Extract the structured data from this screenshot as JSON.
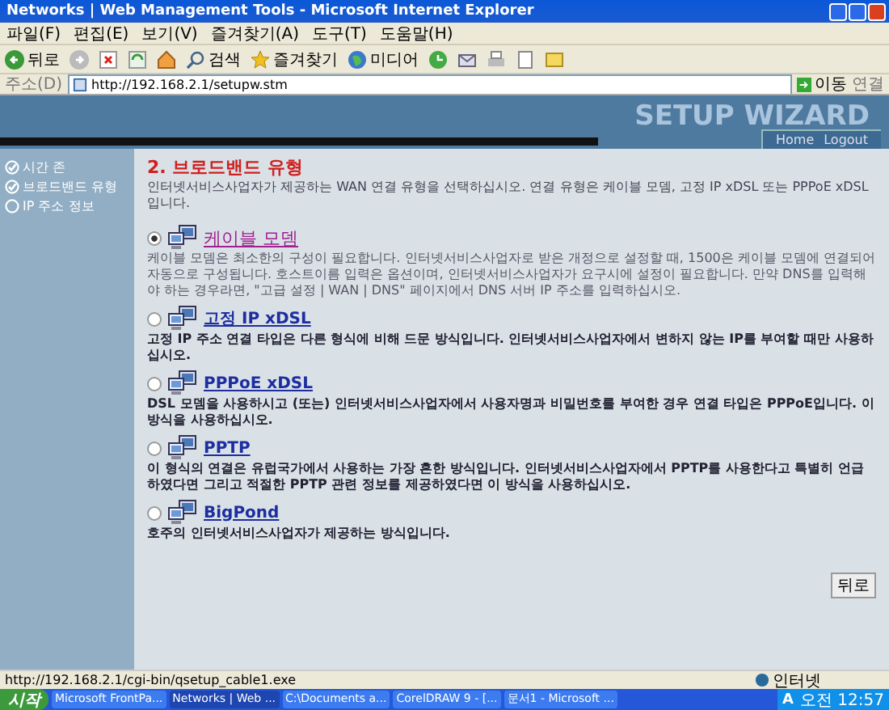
{
  "window": {
    "title": "Networks | Web Management Tools - Microsoft Internet Explorer"
  },
  "menu": [
    "파일(F)",
    "편집(E)",
    "보기(V)",
    "즐겨찾기(A)",
    "도구(T)",
    "도움말(H)"
  ],
  "toolbar": {
    "back": "뒤로",
    "search": "검색",
    "favorites": "즐겨찾기",
    "media": "미디어"
  },
  "address_bar": {
    "label": "주소(D)",
    "value": "http://192.168.2.1/setupw.stm",
    "go": "이동",
    "links": "연결"
  },
  "banner": {
    "title": "SETUP WIZARD",
    "home": "Home",
    "logout": "Logout"
  },
  "sidebar": {
    "items": [
      {
        "label": "시간 존",
        "checked": true
      },
      {
        "label": "브로드밴드 유형",
        "checked": true
      },
      {
        "label": "IP 주소 정보",
        "checked": false
      }
    ]
  },
  "heading": "2. 브로드밴드 유형",
  "intro": "인터넷서비스사업자가 제공하는 WAN 연결 유형을 선택하십시오. 연결 유형은 케이블 모뎀, 고정 IP xDSL 또는 PPPoE xDSL 입니다.",
  "options": [
    {
      "label": "케이블 모뎀",
      "selected": true,
      "description": "케이블 모뎀은 최소한의 구성이 필요합니다. 인터넷서비스사업자로 받은 개정으로 설정할 때, 1500은 케이블 모뎀에 연결되어 자동으로 구성됩니다. 호스트이름 입력은 옵션이며, 인터넷서비스사업자가 요구시에 설정이 필요합니다. 만약 DNS를 입력해야 하는 경우라면, \"고급 설정 | WAN | DNS\" 페이지에서 DNS 서버 IP 주소를 입력하십시오."
    },
    {
      "label": "고정 IP xDSL",
      "selected": false,
      "description": "고정 IP 주소 연결 타입은 다른 형식에 비해 드문 방식입니다. 인터넷서비스사업자에서 변하지 않는 IP를 부여할 때만 사용하십시오."
    },
    {
      "label": "PPPoE xDSL",
      "selected": false,
      "description": "DSL 모뎀을 사용하시고 (또는) 인터넷서비스사업자에서 사용자명과 비밀번호를 부여한 경우 연결 타입은 PPPoE입니다. 이 방식을 사용하십시오."
    },
    {
      "label": "PPTP",
      "selected": false,
      "description": "이 형식의 연결은 유럽국가에서 사용하는 가장 흔한 방식입니다. 인터넷서비스사업자에서 PPTP를 사용한다고 특별히 언급하였다면 그리고 적절한 PPTP 관련 정보를 제공하였다면 이 방식을 사용하십시오."
    },
    {
      "label": "BigPond",
      "selected": false,
      "description": "호주의 인터넷서비스사업자가 제공하는 방식입니다."
    }
  ],
  "back_button": "뒤로",
  "status_bar": {
    "url": "http://192.168.2.1/cgi-bin/qsetup_cable1.exe",
    "zone": "인터넷"
  },
  "taskbar": {
    "start": "시작",
    "tasks": [
      {
        "label": "Microsoft FrontPa...",
        "selected": false
      },
      {
        "label": "Networks | Web ...",
        "selected": true
      },
      {
        "label": "C:\\Documents a...",
        "selected": false
      },
      {
        "label": "CorelDRAW 9 - [...",
        "selected": false
      },
      {
        "label": "문서1 - Microsoft ...",
        "selected": false
      }
    ],
    "tray": "A",
    "clock": "오전 12:57"
  }
}
